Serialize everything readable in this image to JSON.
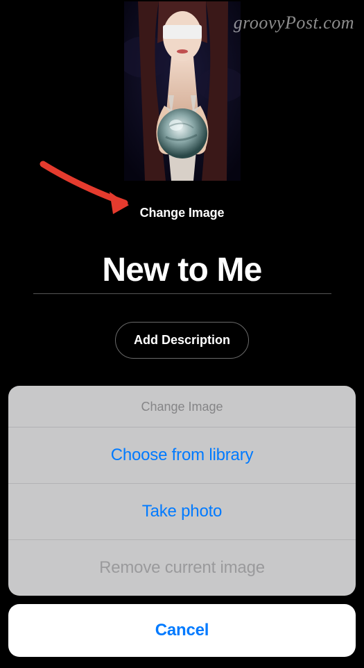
{
  "watermark": "groovyPost.com",
  "editor": {
    "change_label": "Change Image",
    "title": "New to Me",
    "add_description": "Add Description"
  },
  "action_sheet": {
    "title": "Change Image",
    "options": {
      "library": "Choose from library",
      "camera": "Take photo",
      "remove": "Remove current image"
    },
    "cancel": "Cancel"
  }
}
